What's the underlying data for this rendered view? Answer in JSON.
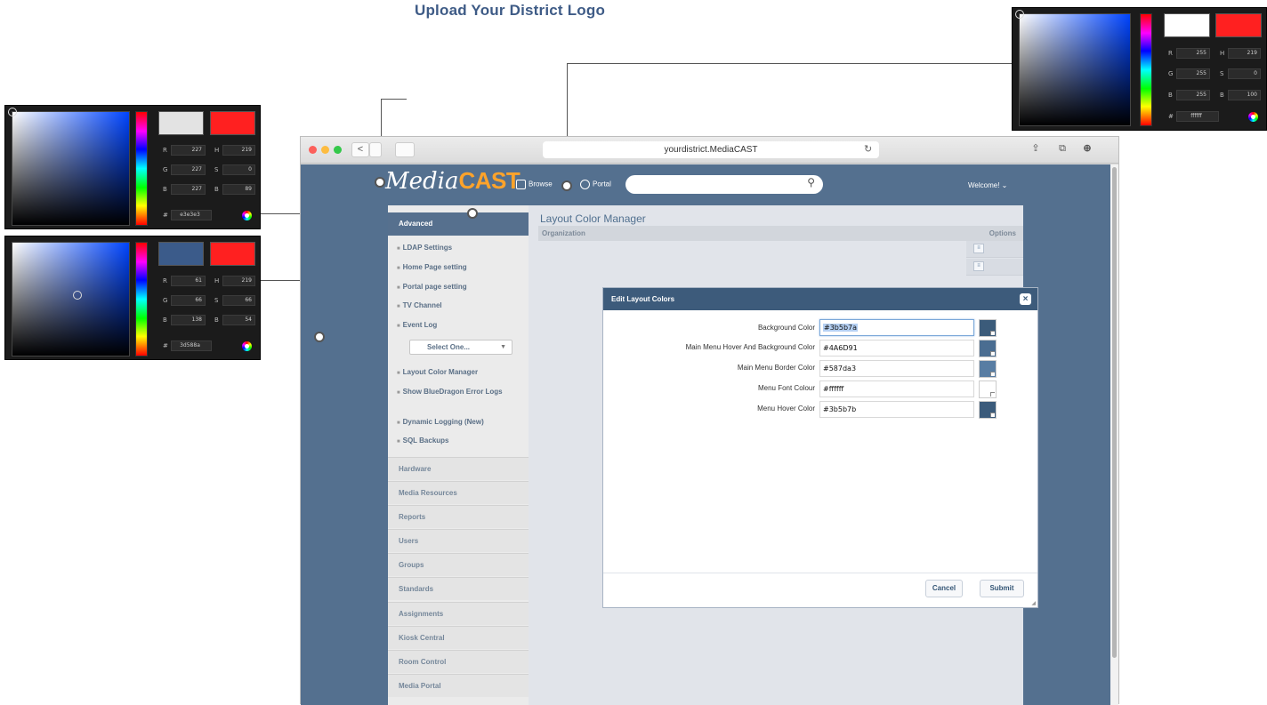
{
  "heading": "Upload Your District Logo",
  "pickers": [
    {
      "hue": "#0044ff",
      "preview": "#e3e3e3",
      "compare": "#ff2020",
      "r": "227",
      "g": "227",
      "b": "227",
      "h": "219",
      "s": "0",
      "bri": "89",
      "hex_value": "e3e3e3"
    },
    {
      "hue": "#0044ff",
      "preview": "#3b5b8a",
      "compare": "#ff2020",
      "r": "61",
      "g": "66",
      "b": "138",
      "h": "219",
      "s": "66",
      "bri": "54",
      "hex_value": "3d588a"
    },
    {
      "hue": "#0044ff",
      "preview": "#ffffff",
      "compare": "#ff2020",
      "r": "255",
      "g": "255",
      "b": "255",
      "h": "219",
      "s": "0",
      "bri": "100",
      "hex_value": "ffffff"
    }
  ],
  "picker_labels": {
    "r": "R",
    "g": "G",
    "b": "B",
    "h": "H",
    "s": "S",
    "bri": "B",
    "hash": "#"
  },
  "browser": {
    "url": "yourdistrict.MediaCAST",
    "back": "<",
    "reload": "↻",
    "share": "⇪",
    "tabs": "⧉",
    "download": "⊕"
  },
  "header": {
    "logo_media": "Media",
    "logo_cast": "CAST",
    "browse": "Browse",
    "portal": "Portal",
    "welcome": "Welcome! ⌄"
  },
  "sidebar": {
    "title": "Advanced",
    "items": [
      "LDAP Settings",
      "Home Page setting",
      "Portal page setting",
      "TV Channel",
      "Event Log"
    ],
    "select": "Select One...",
    "items2": [
      "Layout Color Manager",
      "Show BlueDragon Error Logs",
      "Dynamic Logging (New)",
      "SQL Backups"
    ],
    "sections": [
      "Hardware",
      "Media Resources",
      "Reports",
      "Users",
      "Groups",
      "Standards",
      "Assignments",
      "Kiosk Central",
      "Room Control",
      "Media Portal"
    ]
  },
  "main": {
    "title": "Layout Color Manager",
    "col_org": "Organization",
    "col_options": "Options"
  },
  "modal": {
    "title": "Edit Layout Colors",
    "close": "×",
    "fields": [
      {
        "label": "Background Color",
        "value": "#3b5b7a",
        "swatch": "#3b5b7a"
      },
      {
        "label": "Main Menu Hover And Background Color",
        "value": "#4A6D91",
        "swatch": "#4a6d91"
      },
      {
        "label": "Main Menu Border Color",
        "value": "#587da3",
        "swatch": "#587da3"
      },
      {
        "label": "Menu Font Colour",
        "value": "#ffffff",
        "swatch": "#ffffff"
      },
      {
        "label": "Menu Hover Color",
        "value": "#3b5b7b",
        "swatch": "#3b5b7b"
      }
    ],
    "cancel": "Cancel",
    "submit": "Submit"
  },
  "colors": {
    "app_background": "#54708f",
    "accent_orange": "#ffa32a",
    "modal_header": "#3d5b7b"
  }
}
